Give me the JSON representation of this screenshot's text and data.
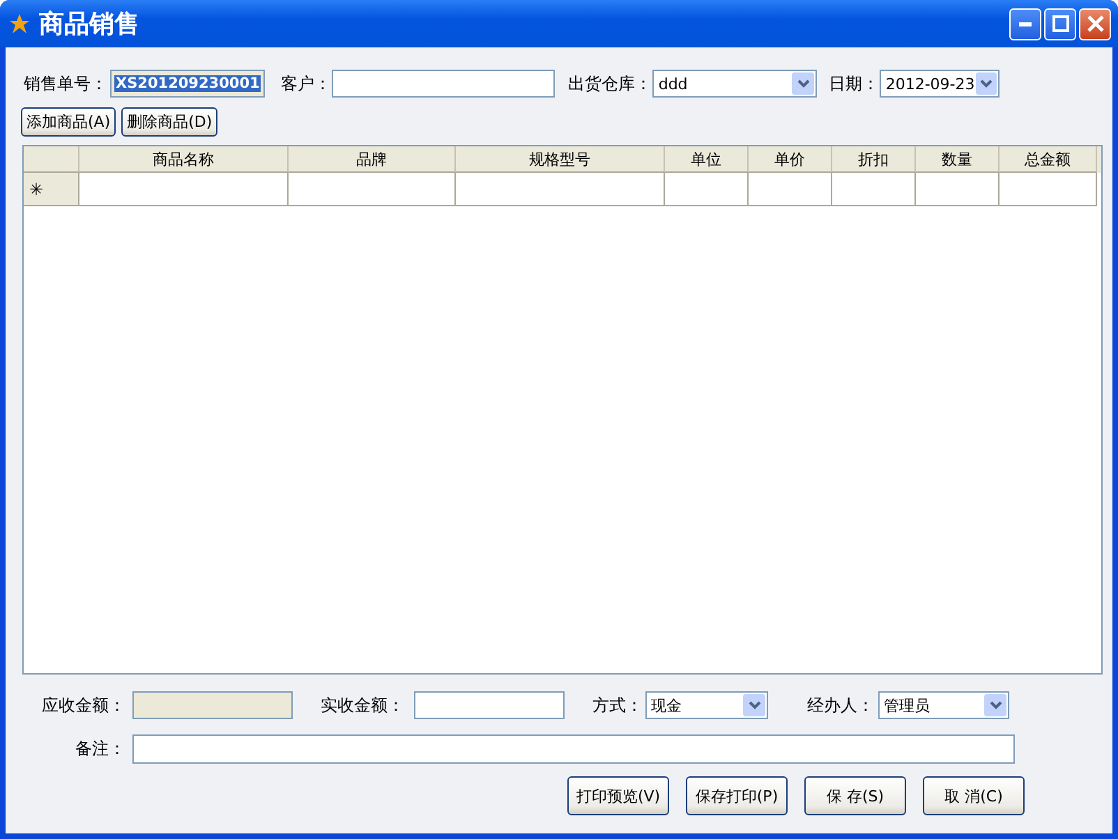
{
  "window": {
    "title": "商品销售"
  },
  "header": {
    "order_no": {
      "label": "销售单号：",
      "value": "XS201209230001",
      "selected": true
    },
    "customer": {
      "label": "客户："
    },
    "warehouse": {
      "label": "出货仓库：",
      "value": "ddd"
    },
    "date": {
      "label": "日期：",
      "value": "2012-09-23"
    }
  },
  "toolbar": [
    "添加商品(A)",
    "删除商品(D)"
  ],
  "table": {
    "columns": [
      "商品名称",
      "品牌",
      "规格型号",
      "单位",
      "单价",
      "折扣",
      "数量",
      "总金额"
    ],
    "new_row_marker": "✳"
  },
  "footer": {
    "receivable": {
      "label": "应收金额：",
      "disabled": true
    },
    "received": {
      "label": "实收金额："
    },
    "method": {
      "label": "方式：",
      "value": "现金"
    },
    "handler": {
      "label": "经办人：",
      "value": "管理员"
    },
    "remark": {
      "label": "备注："
    }
  },
  "buttons": [
    "打印预览(V)",
    "保存打印(P)",
    "保 存(S)",
    "取 消(C)"
  ]
}
